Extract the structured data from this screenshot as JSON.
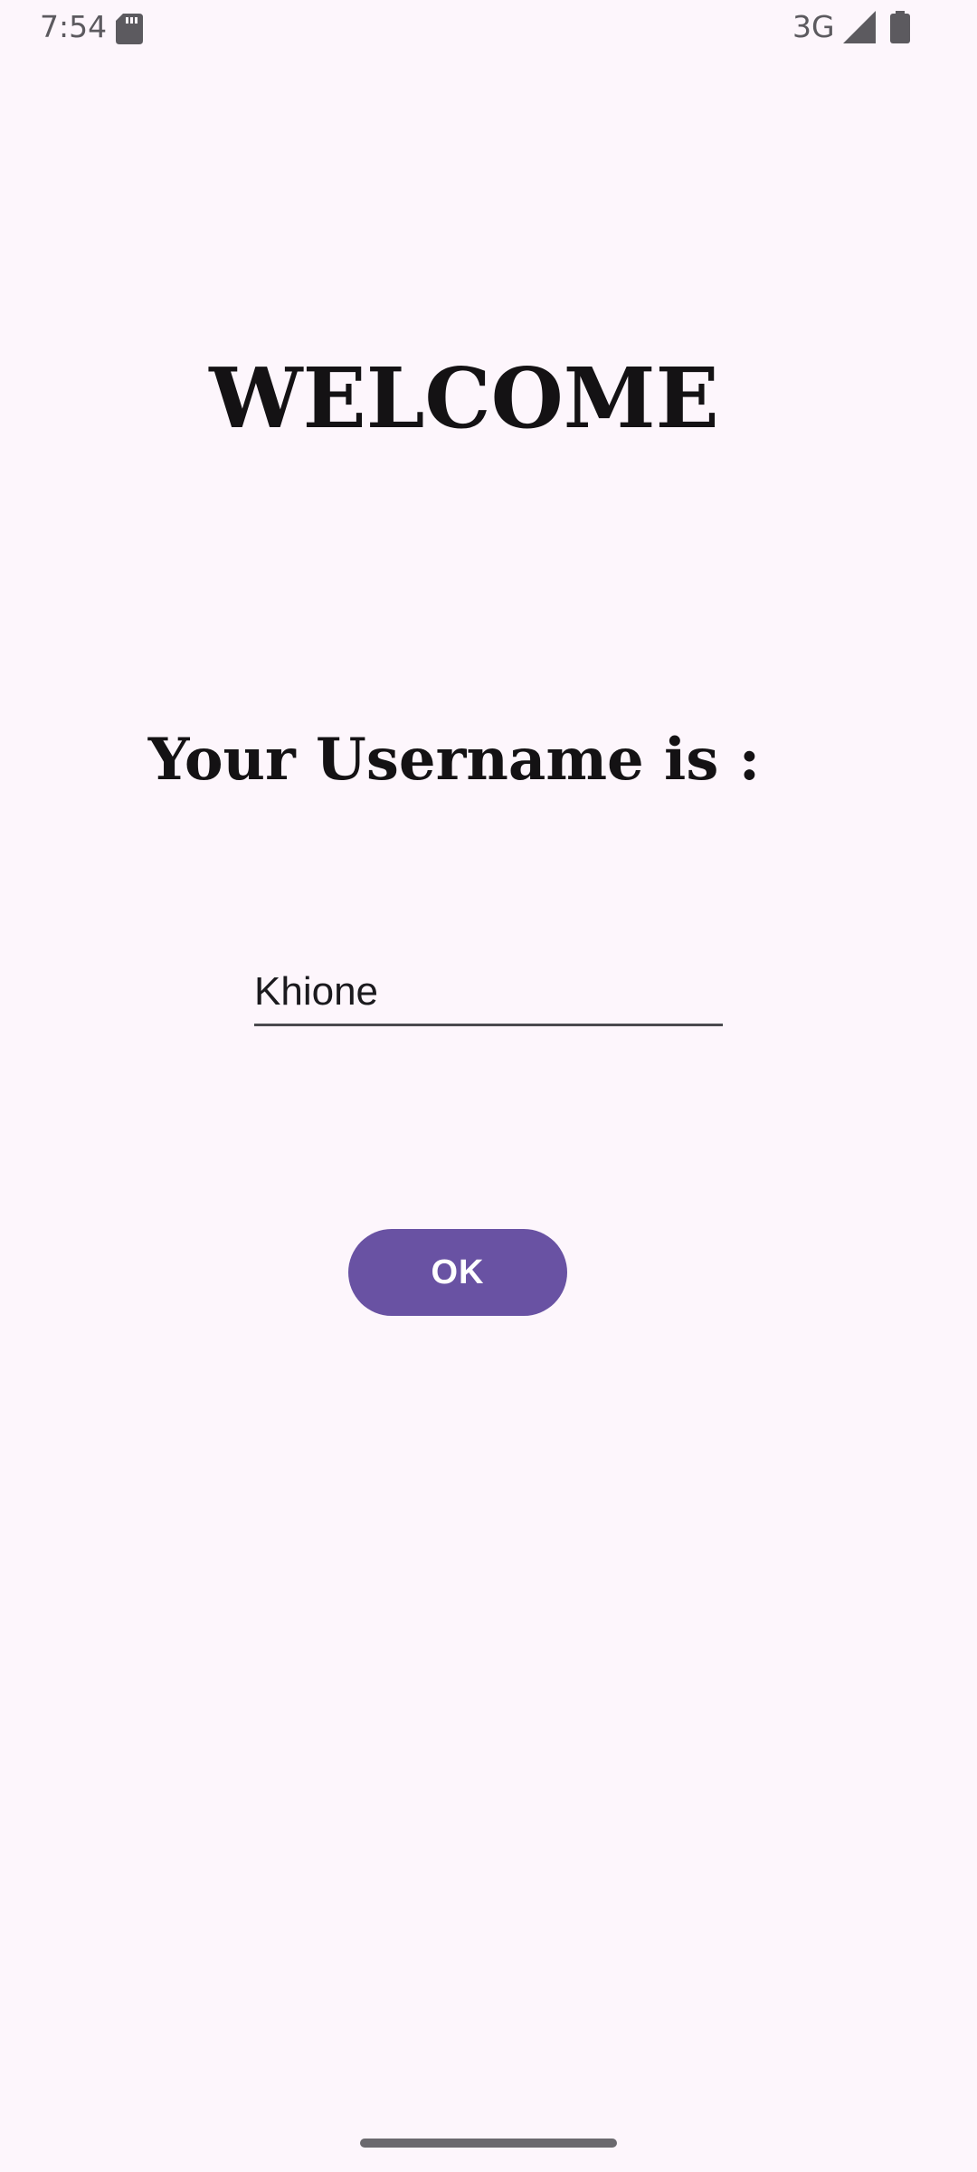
{
  "status_bar": {
    "time": "7:54",
    "network": "3G",
    "icons": [
      "sd-card-icon",
      "signal-icon",
      "battery-icon"
    ],
    "icon_color": "#5c5a5f"
  },
  "main": {
    "title": "WELCOME",
    "label": "Your Username is :",
    "username_value": "Khione",
    "ok_label": "OK"
  },
  "colors": {
    "background": "#fdf6fc",
    "accent": "#6952a3",
    "text": "#141214"
  }
}
